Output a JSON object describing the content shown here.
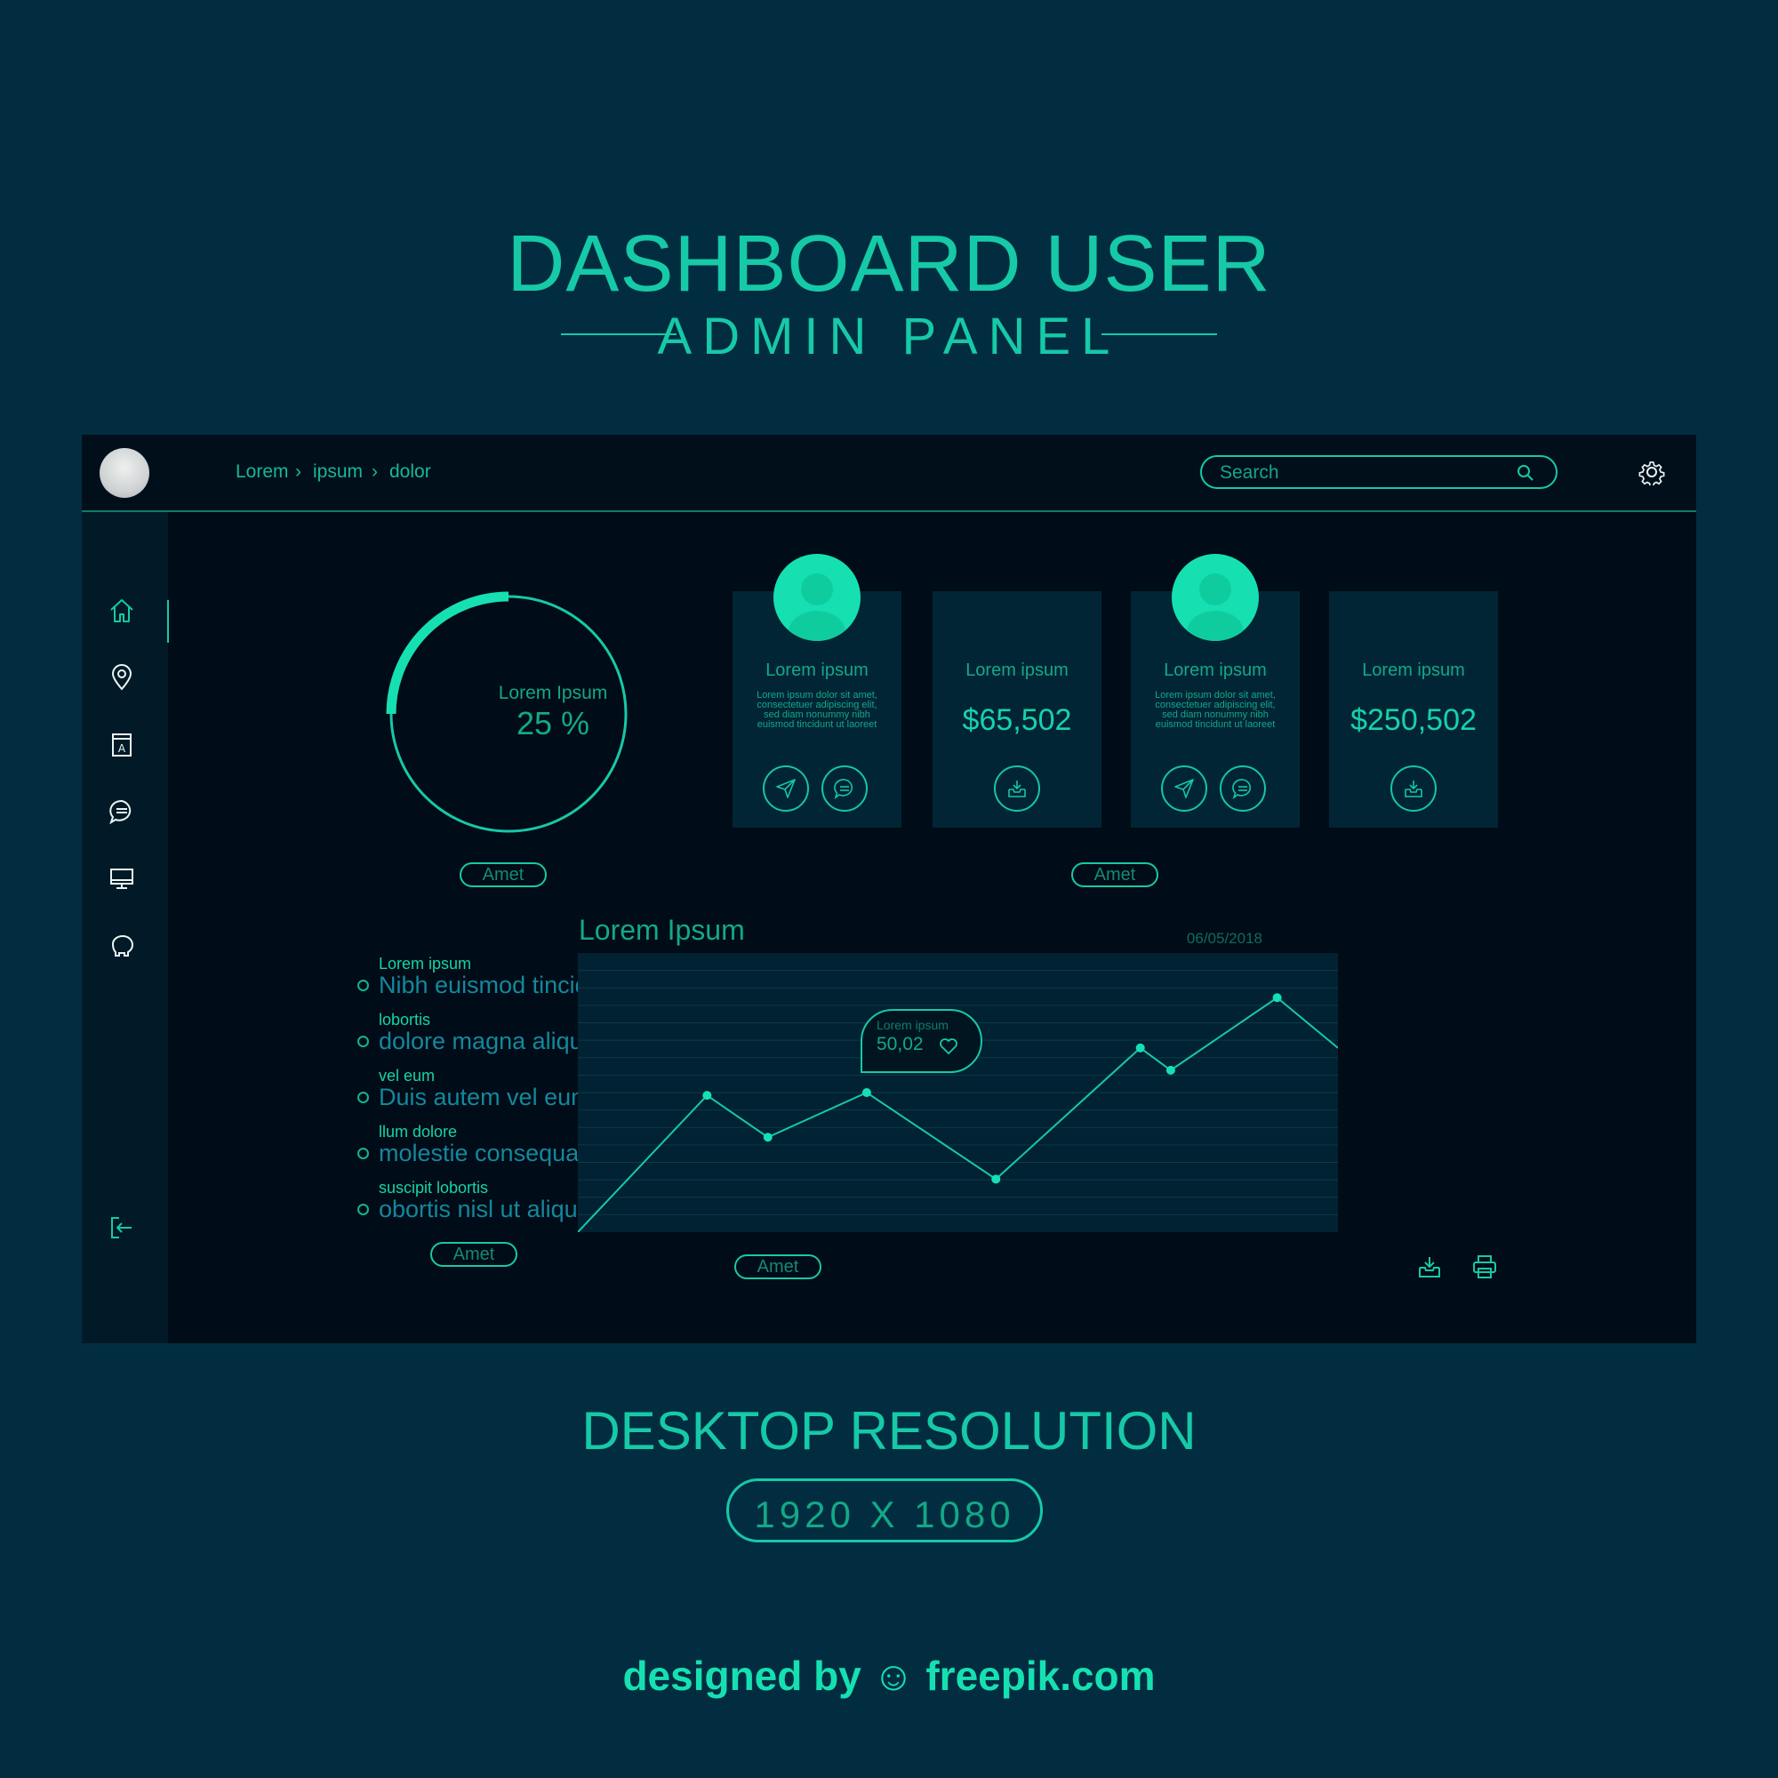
{
  "hero": {
    "title": "DASHBOARD USER",
    "subtitle": "ADMIN PANEL"
  },
  "topbar": {
    "breadcrumb": [
      "Lorem",
      "ipsum",
      "dolor"
    ],
    "search_placeholder": "Search"
  },
  "sidebar": {
    "items": [
      {
        "icon": "home-icon",
        "active": true
      },
      {
        "icon": "location-pin-icon"
      },
      {
        "icon": "book-icon"
      },
      {
        "icon": "chat-icon"
      },
      {
        "icon": "monitor-icon"
      },
      {
        "icon": "piggy-bank-icon"
      }
    ],
    "logout_icon": "logout-icon"
  },
  "progress": {
    "label": "Lorem Ipsum",
    "value": "25 %",
    "fraction": 0.25
  },
  "buttons": {
    "amet": "Amet"
  },
  "cards": [
    {
      "title": "Lorem ipsum",
      "text": "Lorem ipsum dolor sit amet, consectetuer adipiscing elit, sed diam nonummy nibh euismod tincidunt ut laoreet"
    },
    {
      "title": "Lorem ipsum",
      "price": "$65,502"
    },
    {
      "title": "Lorem ipsum",
      "text": "Lorem ipsum dolor sit amet, consectetuer adipiscing elit, sed diam nonummy nibh euismod tincidunt ut laoreet"
    },
    {
      "title": "Lorem ipsum",
      "price": "$250,502"
    }
  ],
  "list": [
    {
      "small": "Lorem ipsum",
      "big": "Nibh euismod tincidunt"
    },
    {
      "small": "lobortis",
      "big": "dolore magna aliquam"
    },
    {
      "small": "vel eum",
      "big": "Duis autem vel eum"
    },
    {
      "small": "llum dolore",
      "big": "molestie consequat"
    },
    {
      "small": "suscipit lobortis",
      "big": "obortis nisl ut aliquip"
    }
  ],
  "chart": {
    "title": "Lorem Ipsum",
    "date": "06/05/2018",
    "tooltip_label": "Lorem ipsum",
    "tooltip_value": "50,02"
  },
  "chart_data": {
    "type": "line",
    "title": "Lorem Ipsum",
    "values": [
      0,
      49,
      34,
      50,
      19,
      66,
      58,
      84,
      66
    ],
    "x": [
      0,
      0.17,
      0.25,
      0.38,
      0.55,
      0.74,
      0.78,
      0.92,
      1.0
    ],
    "ylim": [
      0,
      100
    ],
    "grid": true,
    "colors": {
      "line": "#16c9a7",
      "point": "#16e0b2"
    }
  },
  "footer": {
    "resolution_title": "DESKTOP RESOLUTION",
    "resolution_value": "1920 X 1080",
    "credit": "designed by ☺ freepik.com"
  },
  "colors": {
    "accent": "#16c9a7",
    "background": "#022d40",
    "panel": "#000c17"
  }
}
